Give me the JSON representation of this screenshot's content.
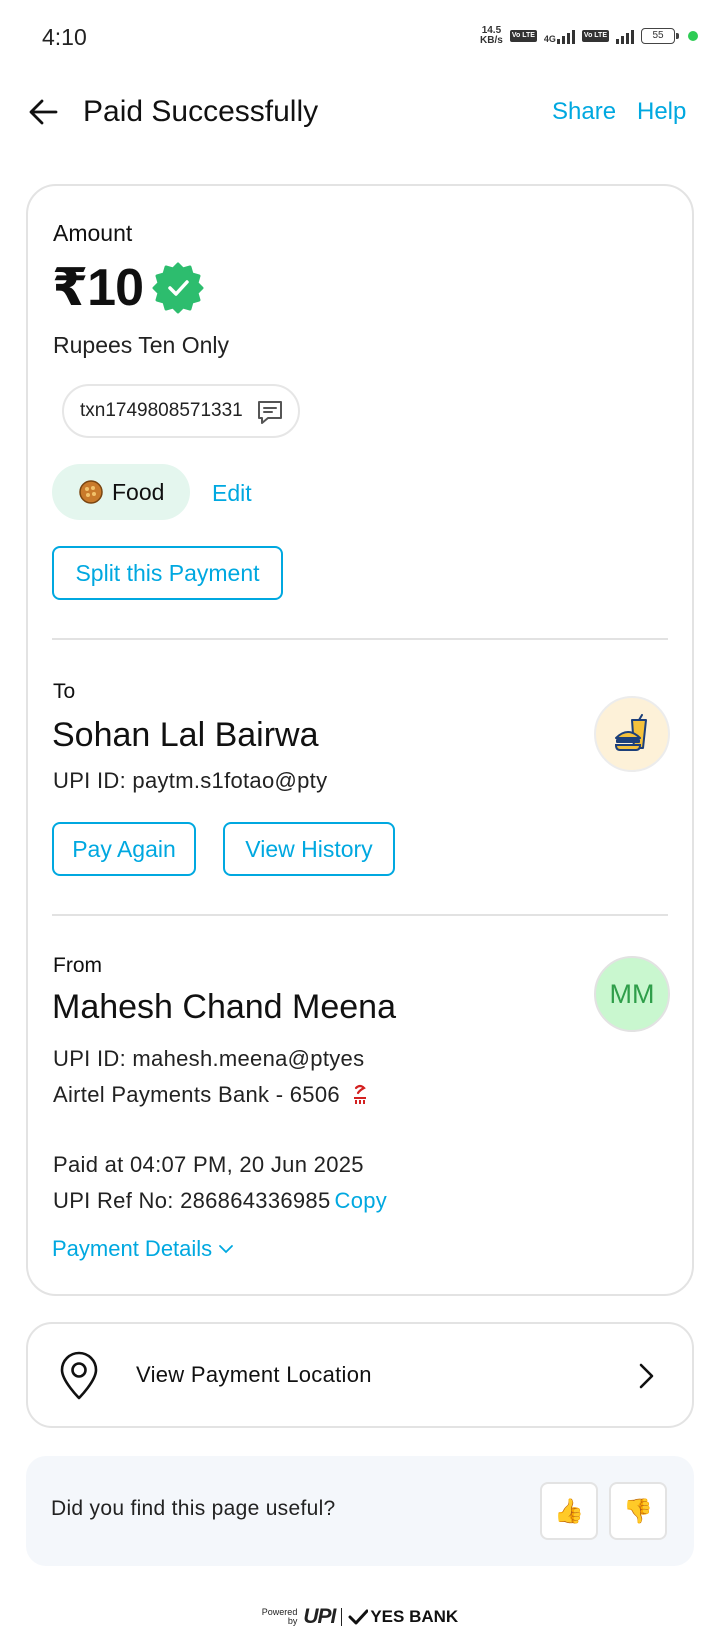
{
  "status_bar": {
    "time": "4:10",
    "net_speed_top": "14.5",
    "net_speed_bottom": "KB/s",
    "volte_label": "Vo LTE",
    "network_4g": "4G",
    "battery": "55"
  },
  "header": {
    "title": "Paid Successfully",
    "share_label": "Share",
    "help_label": "Help"
  },
  "amount": {
    "label": "Amount",
    "value": "₹10",
    "in_words": "Rupees Ten Only",
    "verified_color": "#2dbd6e"
  },
  "transaction": {
    "note": "txn1749808571331"
  },
  "category": {
    "label": "Food",
    "icon": "food-bowl-icon",
    "edit_label": "Edit"
  },
  "split_button_label": "Split this Payment",
  "to": {
    "label": "To",
    "name": "Sohan Lal Bairwa",
    "upi_id": "UPI ID: paytm.s1fotao@pty",
    "avatar_icon": "food-drink-merchant-icon",
    "pay_again_label": "Pay Again",
    "view_history_label": "View History"
  },
  "from": {
    "label": "From",
    "name": "Mahesh Chand Meena",
    "initials": "MM",
    "upi_id": "UPI ID: mahesh.meena@ptyes",
    "bank": "Airtel Payments Bank - 6506",
    "paid_at": "Paid at 04:07 PM, 20 Jun 2025",
    "ref_no": "UPI Ref No: 286864336985",
    "copy_label": "Copy",
    "payment_details_label": "Payment Details"
  },
  "location": {
    "label": "View Payment Location"
  },
  "feedback": {
    "question": "Did you find this page useful?",
    "thumbs_up": "👍",
    "thumbs_down": "👎"
  },
  "footer": {
    "powered_line1": "Powered",
    "powered_line2": "by",
    "upi_logo": "UPI",
    "bank_brand": "YES BANK"
  },
  "colors": {
    "accent": "#00a8e0",
    "verified": "#2dbd6e",
    "food_chip_bg": "#e4f6ee",
    "payer_avatar_bg": "#c9f7cf"
  }
}
